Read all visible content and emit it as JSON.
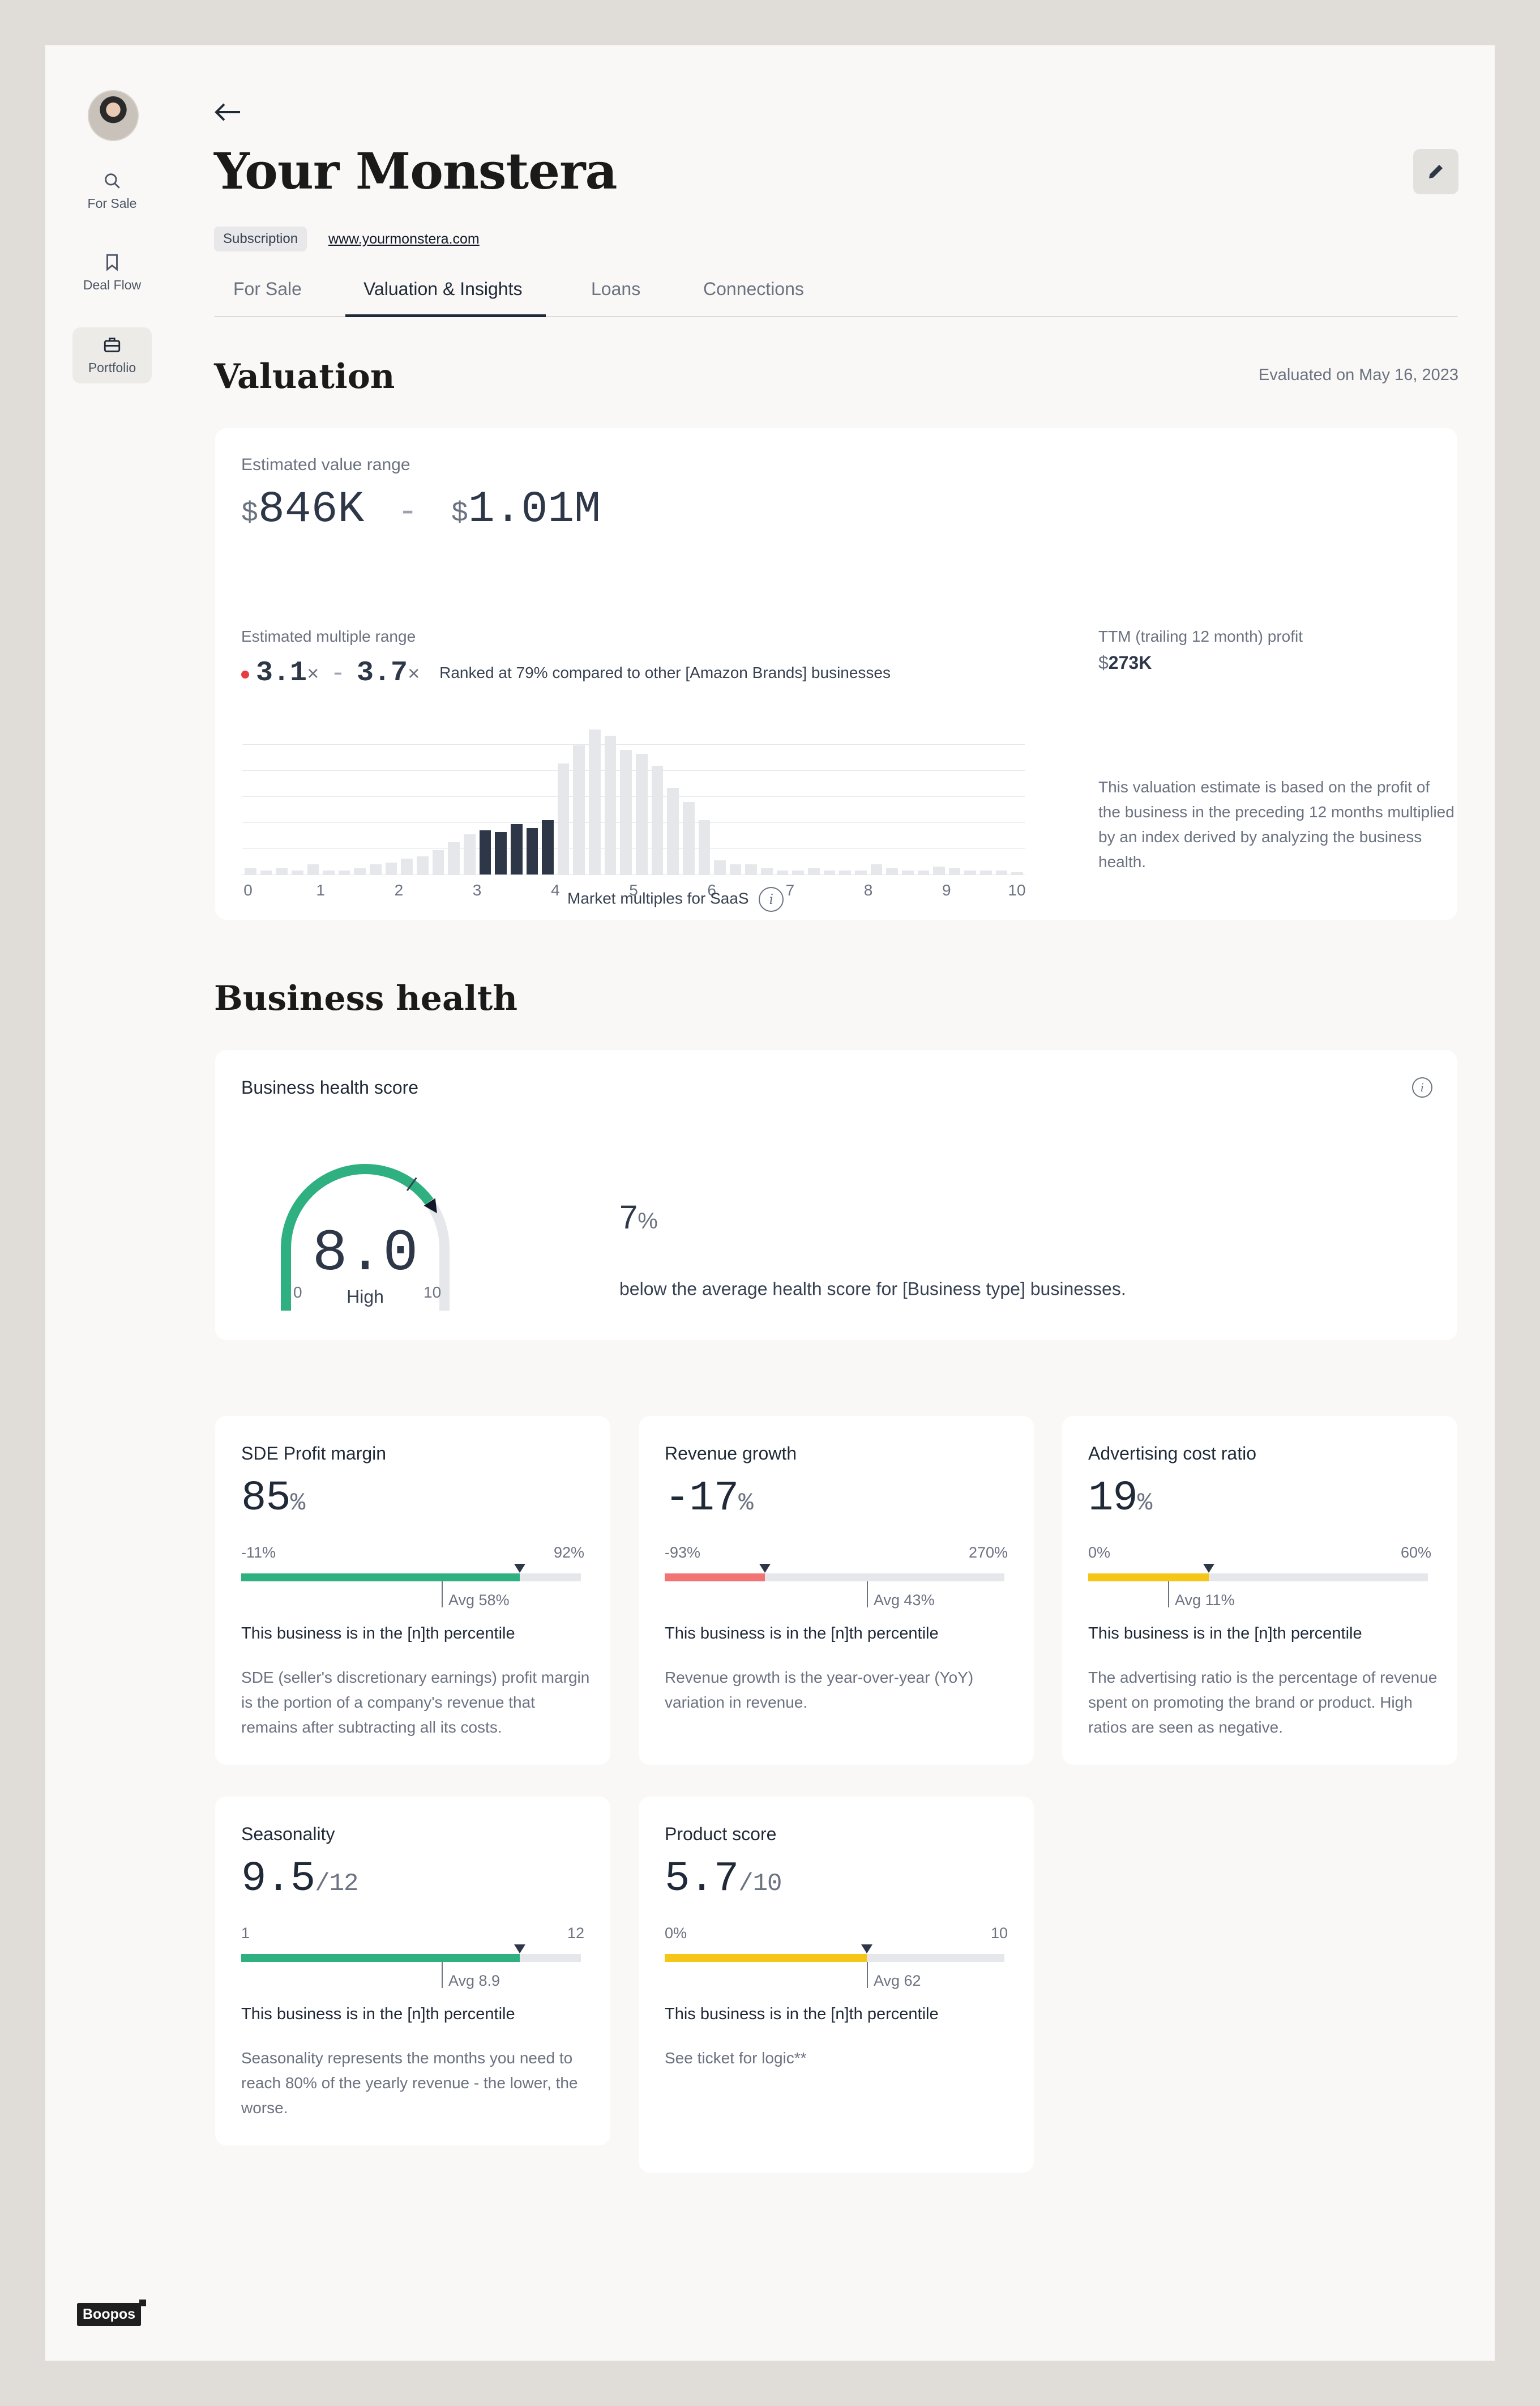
{
  "sidebar": {
    "items": [
      {
        "label": "For Sale",
        "icon": "search-icon"
      },
      {
        "label": "Deal Flow",
        "icon": "bookmark-icon"
      },
      {
        "label": "Portfolio",
        "icon": "briefcase-icon",
        "active": true
      }
    ],
    "logo": "Boopos"
  },
  "header": {
    "title": "Your Monstera",
    "badge": "Subscription",
    "url": "www.yourmonstera.com"
  },
  "tabs": [
    {
      "label": "For Sale"
    },
    {
      "label": "Valuation & Insights",
      "active": true
    },
    {
      "label": "Loans"
    },
    {
      "label": "Connections"
    }
  ],
  "valuation": {
    "heading": "Valuation",
    "evaluated": "Evaluated on May 16, 2023",
    "value_range_label": "Estimated value range",
    "currency": "$",
    "value_low": "846K",
    "value_sep": "-",
    "value_high": "1.01M",
    "multiple_label": "Estimated multiple range",
    "multiple_low": "3.1",
    "multiple_high": "3.7",
    "multiple_unit": "×",
    "rank_text": "Ranked at 79% compared to other [Amazon Brands] businesses",
    "ttm_label": "TTM (trailing 12 month) profit",
    "ttm_value": "273K",
    "note": "This valuation estimate is based on the profit of the business in the preceding 12 months multiplied by an index derived by analyzing the business health.",
    "chart_caption": "Market multiples for SaaS"
  },
  "chart_data": {
    "type": "bar",
    "title": "",
    "xlabel": "Market multiples for SaaS",
    "ylabel": "",
    "x_ticks": [
      "0",
      "1",
      "2",
      "3",
      "4",
      "5",
      "6",
      "7",
      "8",
      "9",
      "10"
    ],
    "xlim": [
      0,
      10
    ],
    "bin_width": 0.2,
    "values": [
      3,
      2,
      3,
      2,
      5,
      2,
      2,
      3,
      5,
      6,
      8,
      9,
      12,
      16,
      20,
      22,
      21,
      25,
      23,
      27,
      55,
      64,
      72,
      69,
      62,
      60,
      54,
      43,
      36,
      27,
      7,
      5,
      5,
      3,
      2,
      2,
      3,
      2,
      2,
      2,
      5,
      3,
      2,
      2,
      4,
      3,
      2,
      2,
      2,
      1
    ],
    "highlight_range": [
      3.0,
      4.0
    ],
    "grid": true
  },
  "health": {
    "heading": "Business health",
    "score_label": "Business health score",
    "score": "8.0",
    "score_word": "High",
    "gauge_min": "0",
    "gauge_max": "10",
    "gauge_fraction": 0.8,
    "avg_fraction": 0.7,
    "delta_value": "7",
    "delta_unit": "%",
    "delta_text": "below the average health score for [Business type] businesses."
  },
  "metrics": [
    {
      "title": "SDE Profit margin",
      "value": "85",
      "unit": "%",
      "min": "-11%",
      "max": "92%",
      "fill": 0.82,
      "avg": 0.59,
      "avg_label": "Avg 58%",
      "color": "#2fb080",
      "percentile": "This business is in the [n]th percentile",
      "desc": "SDE (seller's discretionary earnings) profit margin is the portion of a company's revenue that remains after subtracting all its costs."
    },
    {
      "title": "Revenue growth",
      "value": "-17",
      "unit": "%",
      "min": "-93%",
      "max": "270%",
      "fill": 0.295,
      "avg": 0.595,
      "avg_label": "Avg 43%",
      "color": "#f27373",
      "percentile": "This business is in the [n]th percentile",
      "desc": "Revenue growth is the year-over-year (YoY) variation in revenue."
    },
    {
      "title": "Advertising cost ratio",
      "value": "19",
      "unit": "%",
      "min": "0%",
      "max": "60%",
      "fill": 0.355,
      "avg": 0.235,
      "avg_label": "Avg 11%",
      "color": "#f5c518",
      "percentile": "This business is in the [n]th percentile",
      "desc": "The advertising ratio is the percentage of revenue spent on promoting the brand or product. High ratios are seen as negative."
    },
    {
      "title": "Seasonality",
      "value": "9.5",
      "unit": "/12",
      "min": "1",
      "max": "12",
      "fill": 0.82,
      "avg": 0.59,
      "avg_label": "Avg 8.9",
      "color": "#2fb080",
      "percentile": "This business is in the [n]th percentile",
      "desc": "Seasonality represents the months you need to reach 80% of the yearly revenue - the lower, the worse."
    },
    {
      "title": "Product score",
      "value": "5.7",
      "unit": "/10",
      "min": "0%",
      "max": "10",
      "fill": 0.595,
      "avg": 0.595,
      "avg_label": "Avg 62",
      "color": "#f5c518",
      "percentile": "This business is in the [n]th percentile",
      "desc": "See ticket for logic**"
    }
  ]
}
